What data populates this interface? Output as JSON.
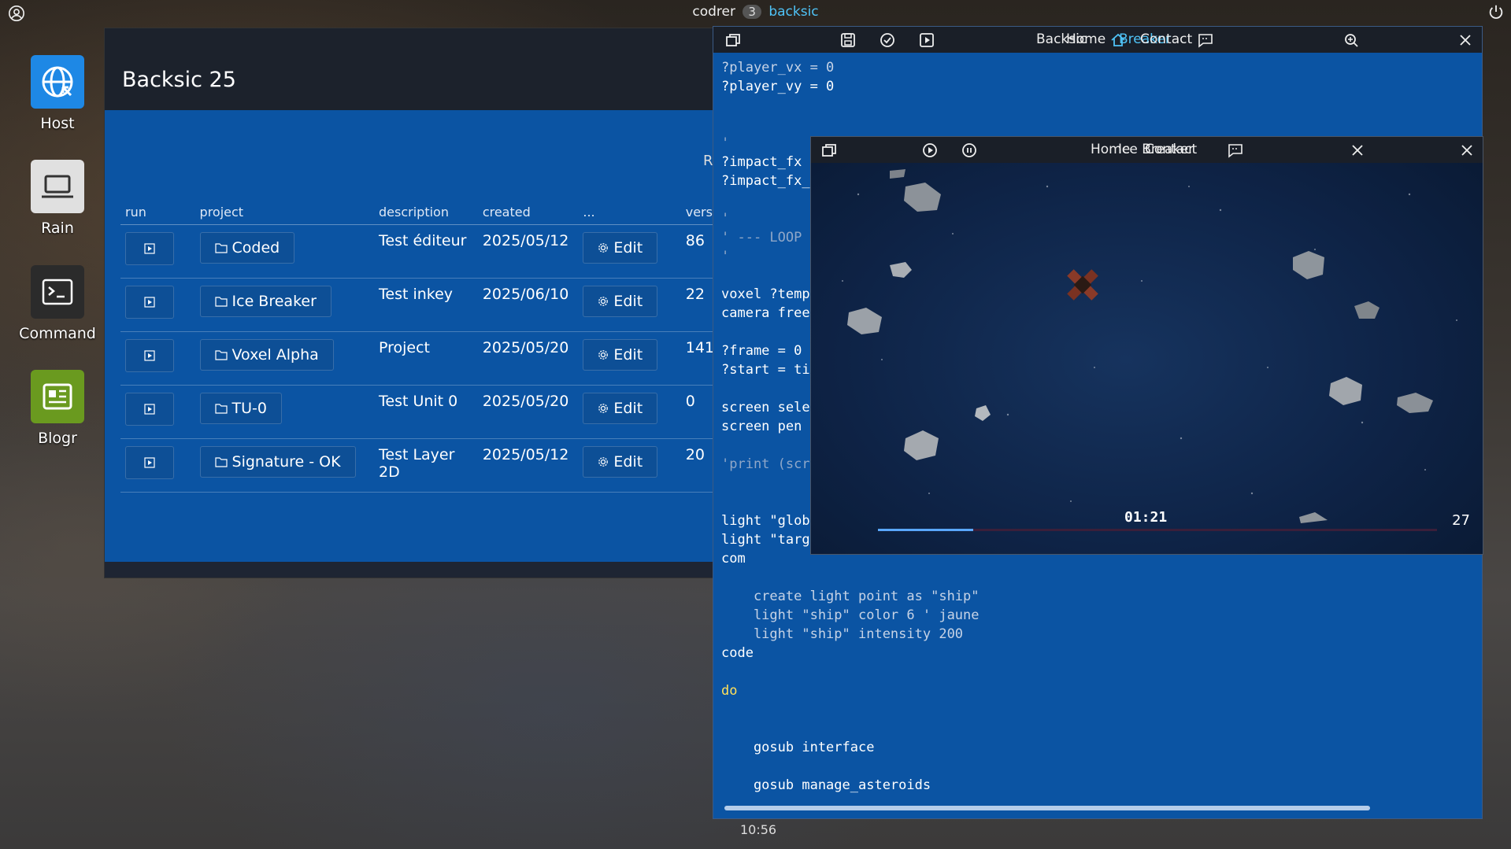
{
  "topbar": {
    "user": "codrer",
    "workspace_badge": "3",
    "active_app": "backsic"
  },
  "desktop": {
    "icons": [
      {
        "label": "Host",
        "icon": "globe-icon",
        "color": "#1e88e5"
      },
      {
        "label": "Rain",
        "icon": "laptop-icon",
        "color": "#e0e0e0"
      },
      {
        "label": "Command",
        "icon": "terminal-icon",
        "color": "#2b2b2b"
      },
      {
        "label": "Blogr",
        "icon": "news-icon",
        "color": "#6a9a1f"
      }
    ]
  },
  "projects_window": {
    "title": "Backsic 25",
    "right_cut_label": "R",
    "columns": [
      "run",
      "project",
      "description",
      "created",
      "...",
      "vers"
    ],
    "rows": [
      {
        "project": "Coded",
        "description": "Test éditeur",
        "created": "2025/05/12",
        "edit": "Edit",
        "version": "86"
      },
      {
        "project": "Ice Breaker",
        "description": "Test inkey",
        "created": "2025/06/10",
        "edit": "Edit",
        "version": "22"
      },
      {
        "project": "Voxel Alpha",
        "description": "Project",
        "created": "2025/05/20",
        "edit": "Edit",
        "version": "141"
      },
      {
        "project": "TU-0",
        "description": "Test Unit 0",
        "created": "2025/05/20",
        "edit": "Edit",
        "version": "0"
      },
      {
        "project": "Signature - OK",
        "description": "Test Layer 2D",
        "created": "2025/05/12",
        "edit": "Edit",
        "version": "20"
      }
    ]
  },
  "code_window": {
    "title": "Backsic",
    "nav_home": "Home",
    "nav_break": "Breaker",
    "nav_contact": "Contact",
    "lines": [
      {
        "t": "?player_vx = 0",
        "c": "dim"
      },
      {
        "t": "?player_vy = 0",
        "c": ""
      },
      {
        "t": "",
        "c": ""
      },
      {
        "t": "",
        "c": ""
      },
      {
        "t": "'",
        "c": "cmt"
      },
      {
        "t": "?impact_fx",
        "c": ""
      },
      {
        "t": "?impact_fx_",
        "c": ""
      },
      {
        "t": "",
        "c": ""
      },
      {
        "t": "'",
        "c": "cmt"
      },
      {
        "t": "' --- LOOP",
        "c": "cmt"
      },
      {
        "t": "'",
        "c": "cmt"
      },
      {
        "t": "",
        "c": ""
      },
      {
        "t": "voxel ?temp",
        "c": ""
      },
      {
        "t": "camera free",
        "c": ""
      },
      {
        "t": "",
        "c": ""
      },
      {
        "t": "?frame = 0",
        "c": ""
      },
      {
        "t": "?start = ti",
        "c": ""
      },
      {
        "t": "",
        "c": ""
      },
      {
        "t": "screen sele",
        "c": ""
      },
      {
        "t": "screen pen",
        "c": ""
      },
      {
        "t": "",
        "c": ""
      },
      {
        "t": "'print (scr",
        "c": "cmt"
      },
      {
        "t": "",
        "c": ""
      },
      {
        "t": "",
        "c": ""
      },
      {
        "t": "light \"glob",
        "c": ""
      },
      {
        "t": "light \"targ",
        "c": ""
      },
      {
        "t": "com",
        "c": ""
      },
      {
        "t": "",
        "c": ""
      },
      {
        "t": "    create light point as \"ship\"",
        "c": "dim"
      },
      {
        "t": "    light \"ship\" color 6 ' jaune",
        "c": "dim"
      },
      {
        "t": "    light \"ship\" intensity 200",
        "c": "dim"
      },
      {
        "t": "code",
        "c": ""
      },
      {
        "t": "",
        "c": ""
      },
      {
        "t": "do",
        "c": "kw"
      },
      {
        "t": "",
        "c": ""
      },
      {
        "t": "",
        "c": ""
      },
      {
        "t": "    gosub interface",
        "c": ""
      },
      {
        "t": "",
        "c": ""
      },
      {
        "t": "    gosub manage_asteroids",
        "c": ""
      }
    ]
  },
  "game_window": {
    "title": "Ice Breaker",
    "nav_home": "Home",
    "nav_contact": "Contact",
    "timer": "01:21",
    "frame": "27",
    "progress": 0.17
  },
  "clock": "10:56"
}
